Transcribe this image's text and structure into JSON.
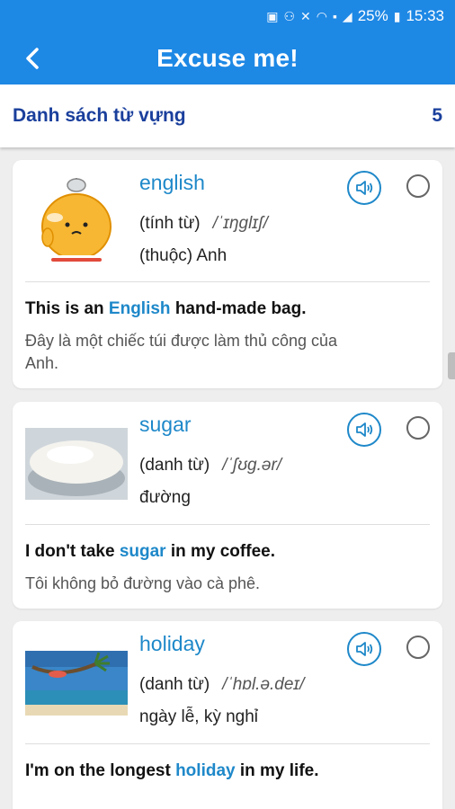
{
  "status_bar": {
    "battery_text": "25%",
    "time": "15:33",
    "icons": [
      "sim-icon",
      "network-icon",
      "mute-icon",
      "wifi-icon",
      "sim-1-icon",
      "signal-icon",
      "battery-icon"
    ]
  },
  "header": {
    "title": "Excuse me!",
    "back_icon": "chevron-left-icon"
  },
  "list_header": {
    "title": "Danh sách từ vựng",
    "count": "5"
  },
  "colors": {
    "primary": "#1e88e5",
    "word": "#1e88c9",
    "heading": "#1a3f9c"
  },
  "words": [
    {
      "word": "english",
      "pos": "(tính từ)",
      "ipa": "/ˈɪŋɡlɪʃ/",
      "meaning": "(thuộc) Anh",
      "example_before": "This is an ",
      "example_highlight": "English",
      "example_after": " hand-made bag.",
      "translation": "Đây là một chiếc túi được làm thủ công của Anh.",
      "image": "mascot-image"
    },
    {
      "word": "sugar",
      "pos": "(danh từ)",
      "ipa": "/ˈʃʊɡ.ər/",
      "meaning": "đường",
      "example_before": "I don't take ",
      "example_highlight": "sugar",
      "example_after": " in my coffee.",
      "translation": "Tôi không bỏ đường vào cà phê.",
      "image": "sugar-image"
    },
    {
      "word": "holiday",
      "pos": "(danh từ)",
      "ipa": "/ˈhɒl.ə.deɪ/",
      "meaning": "ngày lễ, kỳ nghỉ",
      "example_before": "I'm on the longest ",
      "example_highlight": "holiday",
      "example_after": " in my life.",
      "translation": "",
      "image": "beach-image"
    }
  ]
}
